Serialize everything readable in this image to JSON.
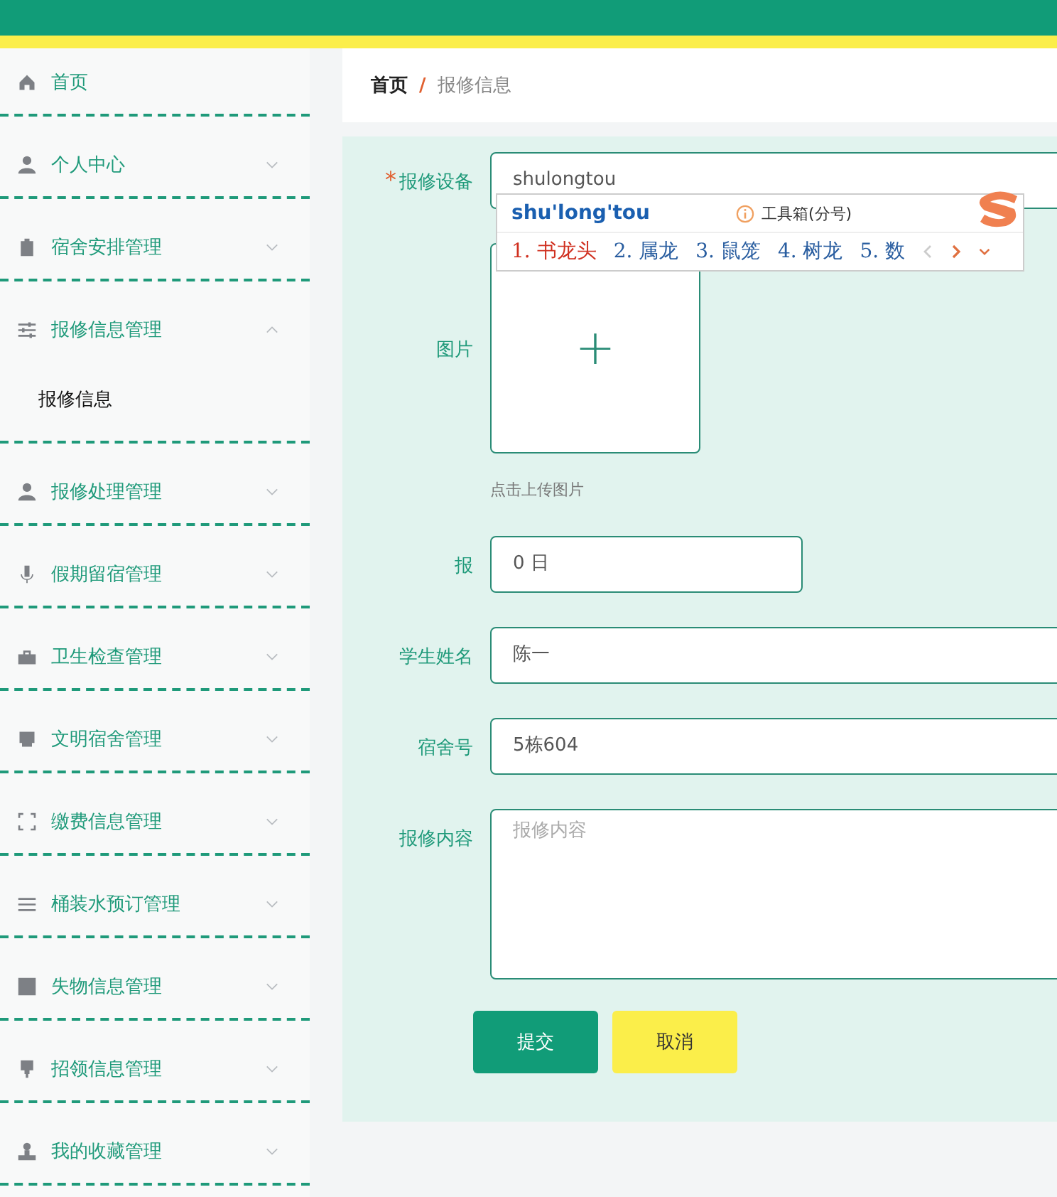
{
  "breadcrumb": {
    "items": [
      {
        "label": "首页",
        "selected": false
      },
      {
        "label": "报修信息",
        "selected": true
      }
    ],
    "separator": "/"
  },
  "sidebar": {
    "items": [
      {
        "label": "首页",
        "kind": "link"
      },
      {
        "label": "个人中心",
        "kind": "submenu",
        "expanded": false
      },
      {
        "label": "宿舍安排管理",
        "kind": "submenu",
        "expanded": false
      },
      {
        "label": "报修信息管理",
        "kind": "submenu",
        "expanded": true,
        "children": [
          {
            "label": "报修信息",
            "selected": true
          }
        ]
      },
      {
        "label": "报修处理管理",
        "kind": "submenu",
        "expanded": false
      },
      {
        "label": "假期留宿管理",
        "kind": "submenu",
        "expanded": false
      },
      {
        "label": "卫生检查管理",
        "kind": "submenu",
        "expanded": false
      },
      {
        "label": "文明宿舍管理",
        "kind": "submenu",
        "expanded": false
      },
      {
        "label": "缴费信息管理",
        "kind": "submenu",
        "expanded": false
      },
      {
        "label": "桶装水预订管理",
        "kind": "submenu",
        "expanded": false
      },
      {
        "label": "失物信息管理",
        "kind": "submenu",
        "expanded": false
      },
      {
        "label": "招领信息管理",
        "kind": "submenu",
        "expanded": false
      },
      {
        "label": "我的收藏管理",
        "kind": "submenu",
        "expanded": false
      }
    ]
  },
  "form": {
    "fields": [
      {
        "kind": "text",
        "label": "报修设备",
        "required_mark": "*",
        "value": "shulongtou"
      },
      {
        "kind": "upload",
        "label": "图片",
        "plus": "+",
        "hint": "点击上传图片"
      },
      {
        "kind": "date",
        "label": "报",
        "value": "0 日"
      },
      {
        "kind": "text",
        "label": "学生姓名",
        "value": "陈一"
      },
      {
        "kind": "text",
        "label": "宿舍号",
        "value": "5栋604"
      },
      {
        "kind": "textarea",
        "label": "报修内容",
        "placeholder": "报修内容"
      }
    ],
    "buttons": [
      {
        "kind": "primary",
        "label": "提交"
      },
      {
        "kind": "secondary",
        "label": "取消"
      }
    ]
  },
  "ime": {
    "composition": "shu'long'tou",
    "toolbox": "工具箱(分号)",
    "candidates": [
      {
        "label": "1. 书龙头",
        "selected": true
      },
      {
        "label": "2. 属龙",
        "selected": false
      },
      {
        "label": "3. 鼠笼",
        "selected": false
      },
      {
        "label": "4. 树龙",
        "selected": false
      },
      {
        "label": "5. 数",
        "selected": false
      }
    ]
  }
}
